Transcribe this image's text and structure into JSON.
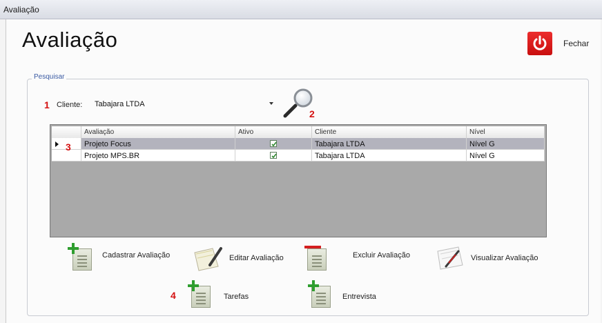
{
  "window": {
    "title": "Avaliação"
  },
  "header": {
    "page_title": "Avaliação",
    "close_label": "Fechar",
    "close_color": "#d91a1a"
  },
  "search": {
    "legend": "Pesquisar",
    "cliente_label": "Cliente:",
    "cliente_value": "Tabajara LTDA",
    "markers": {
      "cliente": "1",
      "search_button": "2",
      "selected_row": "3",
      "tarefas": "4"
    }
  },
  "grid": {
    "columns": [
      "Avaliação",
      "Ativo",
      "Cliente",
      "Nível"
    ],
    "rows": [
      {
        "avaliacao": "Projeto Focus",
        "ativo": true,
        "cliente": "Tabajara LTDA",
        "nivel": "Nível G"
      },
      {
        "avaliacao": "Projeto MPS.BR",
        "ativo": true,
        "cliente": "Tabajara LTDA",
        "nivel": "Nível G"
      }
    ]
  },
  "actions": {
    "cadastrar": "Cadastrar Avaliação",
    "editar": "Editar Avaliação",
    "excluir": "Excluir Avaliação",
    "visualizar": "Visualizar Avaliação",
    "tarefas": "Tarefas",
    "entrevista": "Entrevista"
  },
  "icons": {
    "close": "power-icon",
    "search": "magnifier-icon",
    "add": "plus-document-icon",
    "remove": "minus-document-icon",
    "edit": "pen-paper-icon"
  }
}
